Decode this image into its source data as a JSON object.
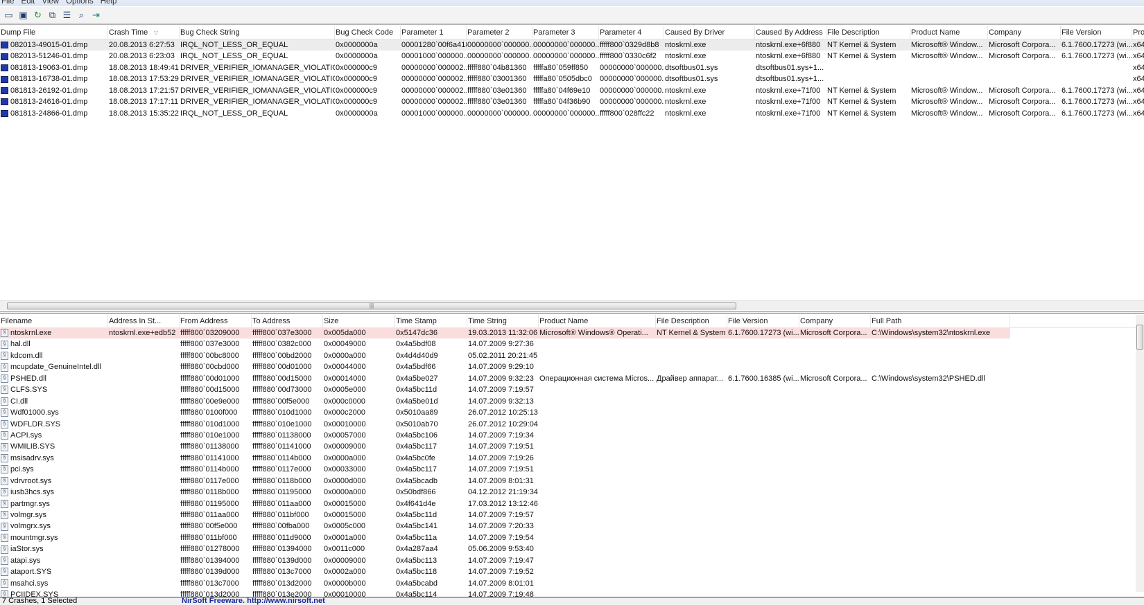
{
  "menu": [
    "File",
    "Edit",
    "View",
    "Options",
    "Help"
  ],
  "toolbar": [
    "options-icon",
    "save-icon",
    "refresh-icon",
    "copy-icon",
    "properties-icon",
    "find-icon",
    "exit-icon"
  ],
  "upper": {
    "columns": [
      "Dump File",
      "Crash Time",
      "Bug Check String",
      "Bug Check Code",
      "Parameter 1",
      "Parameter 2",
      "Parameter 3",
      "Parameter 4",
      "Caused By Driver",
      "Caused By Address",
      "File Description",
      "Product Name",
      "Company",
      "File Version",
      "Pro"
    ],
    "sort_column": "Crash Time",
    "rows": [
      [
        "082013-49015-01.dmp",
        "20.08.2013 6:27:53",
        "IRQL_NOT_LESS_OR_EQUAL",
        "0x0000000a",
        "00001280`00f6a418",
        "00000000`000000...",
        "00000000`000000...",
        "fffff800`0329d8b8",
        "ntoskrnl.exe",
        "ntoskrnl.exe+6f880",
        "NT Kernel & System",
        "Microsoft® Window...",
        "Microsoft Corpora...",
        "6.1.7600.17273 (wi...",
        "x64"
      ],
      [
        "082013-51246-01.dmp",
        "20.08.2013 6:23:03",
        "IRQL_NOT_LESS_OR_EQUAL",
        "0x0000000a",
        "00001000`000000...",
        "00000000`000000...",
        "00000000`000000...",
        "fffff800`0330c6f2",
        "ntoskrnl.exe",
        "ntoskrnl.exe+6f880",
        "NT Kernel & System",
        "Microsoft® Window...",
        "Microsoft Corpora...",
        "6.1.7600.17273 (wi...",
        "x64"
      ],
      [
        "081813-19063-01.dmp",
        "18.08.2013 18:49:41",
        "DRIVER_VERIFIER_IOMANAGER_VIOLATION",
        "0x000000c9",
        "00000000`000002...",
        "fffff880`04b81360",
        "fffffa80`059ff850",
        "00000000`000000...",
        "dtsoftbus01.sys",
        "dtsoftbus01.sys+1...",
        "",
        "",
        "",
        "",
        "x64"
      ],
      [
        "081813-16738-01.dmp",
        "18.08.2013 17:53:29",
        "DRIVER_VERIFIER_IOMANAGER_VIOLATION",
        "0x000000c9",
        "00000000`000002...",
        "fffff880`03001360",
        "fffffa80`0505dbc0",
        "00000000`000000...",
        "dtsoftbus01.sys",
        "dtsoftbus01.sys+1...",
        "",
        "",
        "",
        "",
        "x64"
      ],
      [
        "081813-26192-01.dmp",
        "18.08.2013 17:21:57",
        "DRIVER_VERIFIER_IOMANAGER_VIOLATION",
        "0x000000c9",
        "00000000`000002...",
        "fffff880`03e01360",
        "fffffa80`04f69e10",
        "00000000`000000...",
        "ntoskrnl.exe",
        "ntoskrnl.exe+71f00",
        "NT Kernel & System",
        "Microsoft® Window...",
        "Microsoft Corpora...",
        "6.1.7600.17273 (wi...",
        "x64"
      ],
      [
        "081813-24616-01.dmp",
        "18.08.2013 17:17:11",
        "DRIVER_VERIFIER_IOMANAGER_VIOLATION",
        "0x000000c9",
        "00000000`000002...",
        "fffff880`03e01360",
        "fffffa80`04f36b90",
        "00000000`000000...",
        "ntoskrnl.exe",
        "ntoskrnl.exe+71f00",
        "NT Kernel & System",
        "Microsoft® Window...",
        "Microsoft Corpora...",
        "6.1.7600.17273 (wi...",
        "x64"
      ],
      [
        "081813-24866-01.dmp",
        "18.08.2013 15:35:22",
        "IRQL_NOT_LESS_OR_EQUAL",
        "0x0000000a",
        "00001000`000000...",
        "00000000`000000...",
        "00000000`000000...",
        "fffff800`028ffc22",
        "ntoskrnl.exe",
        "ntoskrnl.exe+71f00",
        "NT Kernel & System",
        "Microsoft® Window...",
        "Microsoft Corpora...",
        "6.1.7600.17273 (wi...",
        "x64"
      ]
    ]
  },
  "lower": {
    "columns": [
      "Filename",
      "Address In St...",
      "From Address",
      "To Address",
      "Size",
      "Time Stamp",
      "Time String",
      "Product Name",
      "File Description",
      "File Version",
      "Company",
      "Full Path"
    ],
    "highlight_color": "#fadede",
    "rows": [
      [
        "ntoskrnl.exe",
        "ntoskrnl.exe+edb52",
        "fffff800`03209000",
        "fffff800`037e3000",
        "0x005da000",
        "0x5147dc36",
        "19.03.2013 11:32:06",
        "Microsoft® Windows® Operati...",
        "NT Kernel & System",
        "6.1.7600.17273 (wi...",
        "Microsoft Corpora...",
        "C:\\Windows\\system32\\ntoskrnl.exe"
      ],
      [
        "hal.dll",
        "",
        "fffff800`037e3000",
        "fffff800`0382c000",
        "0x00049000",
        "0x4a5bdf08",
        "14.07.2009 9:27:36",
        "",
        "",
        "",
        "",
        ""
      ],
      [
        "kdcom.dll",
        "",
        "fffff800`00bc8000",
        "fffff800`00bd2000",
        "0x0000a000",
        "0x4d4d40d9",
        "05.02.2011 20:21:45",
        "",
        "",
        "",
        "",
        ""
      ],
      [
        "mcupdate_GenuineIntel.dll",
        "",
        "fffff880`00cbd000",
        "fffff880`00d01000",
        "0x00044000",
        "0x4a5bdf66",
        "14.07.2009 9:29:10",
        "",
        "",
        "",
        "",
        ""
      ],
      [
        "PSHED.dll",
        "",
        "fffff880`00d01000",
        "fffff880`00d15000",
        "0x00014000",
        "0x4a5be027",
        "14.07.2009 9:32:23",
        "Операционная система Micros...",
        "Драйвер аппарат...",
        "6.1.7600.16385 (wi...",
        "Microsoft Corpora...",
        "C:\\Windows\\system32\\PSHED.dll"
      ],
      [
        "CLFS.SYS",
        "",
        "fffff880`00d15000",
        "fffff880`00d73000",
        "0x0005e000",
        "0x4a5bc11d",
        "14.07.2009 7:19:57",
        "",
        "",
        "",
        "",
        ""
      ],
      [
        "CI.dll",
        "",
        "fffff880`00e9e000",
        "fffff880`00f5e000",
        "0x000c0000",
        "0x4a5be01d",
        "14.07.2009 9:32:13",
        "",
        "",
        "",
        "",
        ""
      ],
      [
        "Wdf01000.sys",
        "",
        "fffff880`0100f000",
        "fffff880`010d1000",
        "0x000c2000",
        "0x5010aa89",
        "26.07.2012 10:25:13",
        "",
        "",
        "",
        "",
        ""
      ],
      [
        "WDFLDR.SYS",
        "",
        "fffff880`010d1000",
        "fffff880`010e1000",
        "0x00010000",
        "0x5010ab70",
        "26.07.2012 10:29:04",
        "",
        "",
        "",
        "",
        ""
      ],
      [
        "ACPI.sys",
        "",
        "fffff880`010e1000",
        "fffff880`01138000",
        "0x00057000",
        "0x4a5bc106",
        "14.07.2009 7:19:34",
        "",
        "",
        "",
        "",
        ""
      ],
      [
        "WMILIB.SYS",
        "",
        "fffff880`01138000",
        "fffff880`01141000",
        "0x00009000",
        "0x4a5bc117",
        "14.07.2009 7:19:51",
        "",
        "",
        "",
        "",
        ""
      ],
      [
        "msisadrv.sys",
        "",
        "fffff880`01141000",
        "fffff880`0114b000",
        "0x0000a000",
        "0x4a5bc0fe",
        "14.07.2009 7:19:26",
        "",
        "",
        "",
        "",
        ""
      ],
      [
        "pci.sys",
        "",
        "fffff880`0114b000",
        "fffff880`0117e000",
        "0x00033000",
        "0x4a5bc117",
        "14.07.2009 7:19:51",
        "",
        "",
        "",
        "",
        ""
      ],
      [
        "vdrvroot.sys",
        "",
        "fffff880`0117e000",
        "fffff880`0118b000",
        "0x0000d000",
        "0x4a5bcadb",
        "14.07.2009 8:01:31",
        "",
        "",
        "",
        "",
        ""
      ],
      [
        "iusb3hcs.sys",
        "",
        "fffff880`0118b000",
        "fffff880`01195000",
        "0x0000a000",
        "0x50bdf866",
        "04.12.2012 21:19:34",
        "",
        "",
        "",
        "",
        ""
      ],
      [
        "partmgr.sys",
        "",
        "fffff880`01195000",
        "fffff880`011aa000",
        "0x00015000",
        "0x4f641d4e",
        "17.03.2012 13:12:46",
        "",
        "",
        "",
        "",
        ""
      ],
      [
        "volmgr.sys",
        "",
        "fffff880`011aa000",
        "fffff880`011bf000",
        "0x00015000",
        "0x4a5bc11d",
        "14.07.2009 7:19:57",
        "",
        "",
        "",
        "",
        ""
      ],
      [
        "volmgrx.sys",
        "",
        "fffff880`00f5e000",
        "fffff880`00fba000",
        "0x0005c000",
        "0x4a5bc141",
        "14.07.2009 7:20:33",
        "",
        "",
        "",
        "",
        ""
      ],
      [
        "mountmgr.sys",
        "",
        "fffff880`011bf000",
        "fffff880`011d9000",
        "0x0001a000",
        "0x4a5bc11a",
        "14.07.2009 7:19:54",
        "",
        "",
        "",
        "",
        ""
      ],
      [
        "iaStor.sys",
        "",
        "fffff880`01278000",
        "fffff880`01394000",
        "0x0011c000",
        "0x4a287aa4",
        "05.06.2009 9:53:40",
        "",
        "",
        "",
        "",
        ""
      ],
      [
        "atapi.sys",
        "",
        "fffff880`01394000",
        "fffff880`0139d000",
        "0x00009000",
        "0x4a5bc113",
        "14.07.2009 7:19:47",
        "",
        "",
        "",
        "",
        ""
      ],
      [
        "ataport.SYS",
        "",
        "fffff880`0139d000",
        "fffff880`013c7000",
        "0x0002a000",
        "0x4a5bc118",
        "14.07.2009 7:19:52",
        "",
        "",
        "",
        "",
        ""
      ],
      [
        "msahci.sys",
        "",
        "fffff880`013c7000",
        "fffff880`013d2000",
        "0x0000b000",
        "0x4a5bcabd",
        "14.07.2009 8:01:01",
        "",
        "",
        "",
        "",
        ""
      ],
      [
        "PCIIDEX.SYS",
        "",
        "fffff880`013d2000",
        "fffff880`013e2000",
        "0x00010000",
        "0x4a5bc114",
        "14.07.2009 7:19:48",
        "",
        "",
        "",
        "",
        ""
      ]
    ]
  },
  "status": {
    "left": "7 Crashes, 1 Selected",
    "right": "NirSoft Freeware.  http://www.nirsoft.net"
  }
}
